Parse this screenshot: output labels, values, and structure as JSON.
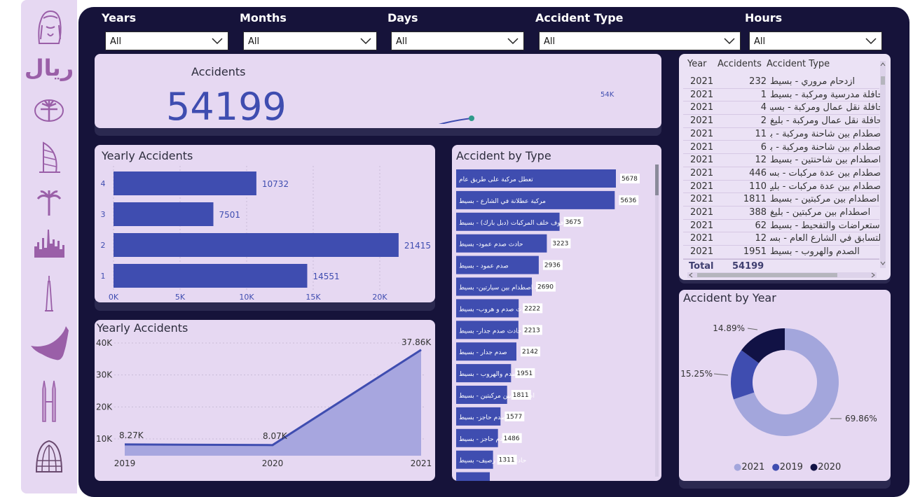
{
  "filters": [
    {
      "label": "Years",
      "value": "All"
    },
    {
      "label": "Months",
      "value": "All"
    },
    {
      "label": "Days",
      "value": "All"
    },
    {
      "label": "Accident Type",
      "value": "All"
    },
    {
      "label": "Hours",
      "value": "All"
    }
  ],
  "sidebar": {
    "icons": [
      "sheikh-portrait-icon",
      "riyal-logo-icon",
      "palm-island-icon",
      "burj-al-arab-icon",
      "palm-tree-icon",
      "dubai-skyline-icon",
      "burj-khalifa-icon",
      "uae-map-icon",
      "twin-towers-icon",
      "dome-tower-icon"
    ],
    "riyal_text": "ريال"
  },
  "kpi": {
    "title": "Accidents",
    "value": "54199",
    "sparkline_label": "54K"
  },
  "yearly_bar": {
    "title": "Yearly Accidents",
    "ticks": [
      "0K",
      "5K",
      "10K",
      "15K",
      "20K"
    ]
  },
  "yearly_area": {
    "title": "Yearly Accidents",
    "yticks": [
      "40K",
      "30K",
      "20K",
      "10K"
    ]
  },
  "by_type": {
    "title": "Accident by Type"
  },
  "table": {
    "headers": [
      "Year",
      "Accidents",
      "Accident Type"
    ],
    "rows": [
      {
        "year": "2021",
        "accidents": "232",
        "type": "ازدحام مروري - بسيط"
      },
      {
        "year": "2021",
        "accidents": "1",
        "type": "حافلة مدرسية ومركبة - بسيط"
      },
      {
        "year": "2021",
        "accidents": "4",
        "type": "حافلة نقل عمال ومركبة - بسيط"
      },
      {
        "year": "2021",
        "accidents": "2",
        "type": "حافلة نقل عمال ومركبة - بليغ"
      },
      {
        "year": "2021",
        "accidents": "11",
        "type": "اصطدام بين شاحنة ومركبة - بسيط"
      },
      {
        "year": "2021",
        "accidents": "6",
        "type": "اصطدام بين شاحنة ومركبة - بليغ"
      },
      {
        "year": "2021",
        "accidents": "12",
        "type": "اصطدام بين شاحنتين - بسيط"
      },
      {
        "year": "2021",
        "accidents": "446",
        "type": "اصطدام بين عدة مركبات - بسيط"
      },
      {
        "year": "2021",
        "accidents": "110",
        "type": "اصطدام بين عدة مركبات - بليغ"
      },
      {
        "year": "2021",
        "accidents": "1811",
        "type": "اصطدام بين مركبتين - بسيط"
      },
      {
        "year": "2021",
        "accidents": "388",
        "type": "اصطدام بين مركبتين - بليغ"
      },
      {
        "year": "2021",
        "accidents": "62",
        "type": "استعراضات والتفحيط - بسيط"
      },
      {
        "year": "2021",
        "accidents": "12",
        "type": "التسابق في الشارع العام - بسيط"
      },
      {
        "year": "2021",
        "accidents": "1951",
        "type": "الصدم والهروب - بسيط"
      }
    ],
    "total_label": "Total",
    "total_value": "54199"
  },
  "donut": {
    "title": "Accident by Year",
    "legend": [
      "2021",
      "2019",
      "2020"
    ]
  },
  "colors": {
    "bar": "#3f4db0",
    "area_fill": "#a7a6df",
    "area_line": "#3f4db0",
    "donut_2021": "#a3a6dc",
    "donut_2019": "#3f4db0",
    "donut_2020": "#111245",
    "card_bg": "#e6d8f2",
    "main_bg": "#16133a"
  },
  "chart_data": [
    {
      "type": "line",
      "title": "Accidents",
      "x": [
        2019,
        2020,
        2021
      ],
      "values": [
        8270,
        8070,
        37860
      ],
      "labels": [
        "",
        "",
        "54K"
      ]
    },
    {
      "type": "bar",
      "title": "Yearly Accidents",
      "orientation": "horizontal",
      "categories": [
        "4",
        "3",
        "2",
        "1"
      ],
      "values": [
        10732,
        7501,
        21415,
        14551
      ],
      "xlim": [
        0,
        24000
      ],
      "xticks": [
        "0K",
        "5K",
        "10K",
        "15K",
        "20K"
      ]
    },
    {
      "type": "area",
      "title": "Yearly Accidents",
      "x": [
        "2019",
        "2020",
        "2021"
      ],
      "values": [
        8270,
        8070,
        37860
      ],
      "data_labels": [
        "8.27K",
        "8.07K",
        "37.86K"
      ],
      "ylim": [
        6000,
        40000
      ],
      "yticks": [
        "10K",
        "20K",
        "30K",
        "40K"
      ]
    },
    {
      "type": "bar",
      "title": "Accident by Type",
      "orientation": "horizontal",
      "categories": [
        "تعطل مركبة على طريق عام",
        "مركبة عطلانة في الشارع - بسيط",
        "الوقوف خلف المركبات (دبل بارك) - بسيط",
        "حادث صدم عمود- بسيط",
        "صدم عمود - بسيط",
        "حادث اصطدام بين سيارتين- بسيط",
        "حادث صدم و هروب- بسيط",
        "حادث صدم جدار- بسيط",
        "صدم جدار - بسيط",
        "الصدم والهروب - بسيط",
        "اصطدام بين مركبتين - بسيط",
        "حادث صدم حاجز- بسيط",
        "صدم حاجز - بسيط",
        "حادث صدم رصيف- بسيط"
      ],
      "values": [
        5678,
        5636,
        3675,
        3223,
        2936,
        2690,
        2222,
        2213,
        2142,
        1951,
        1811,
        1577,
        1486,
        1311
      ],
      "xlim": [
        0,
        6000
      ]
    },
    {
      "type": "pie",
      "title": "Accident by Year",
      "categories": [
        "2021",
        "2019",
        "2020"
      ],
      "values": [
        69.86,
        15.25,
        14.89
      ],
      "labels": [
        "69.86%",
        "15.25%",
        "14.89%"
      ],
      "legend": "bottom"
    }
  ]
}
